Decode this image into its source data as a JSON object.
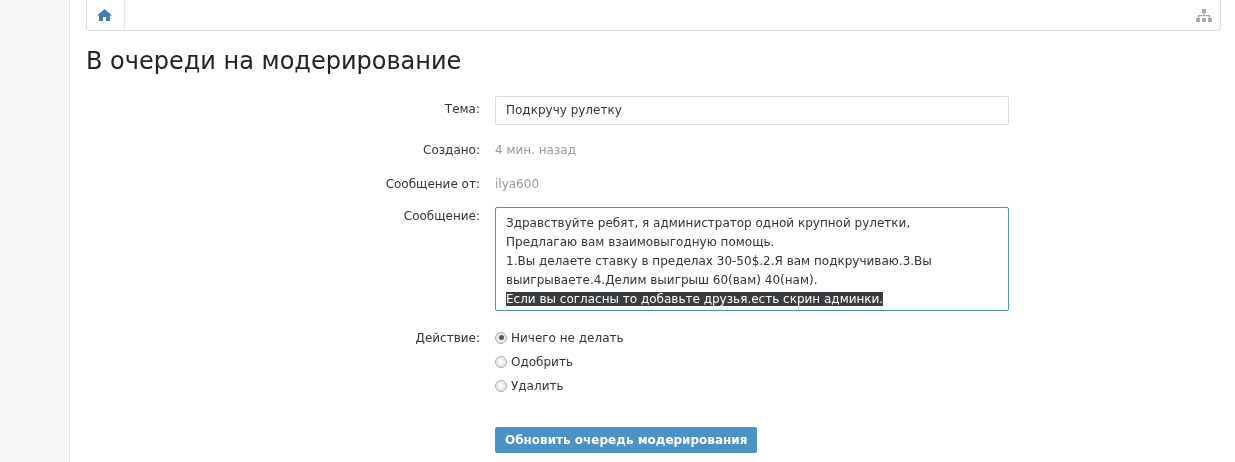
{
  "title": "В очереди на модерирование",
  "fields": [
    {
      "kind": "input",
      "label": "Тема:",
      "value": "Подкручу рулетку"
    },
    {
      "kind": "text",
      "label": "Создано:",
      "value": "4 мин. назад"
    },
    {
      "kind": "text",
      "label": "Сообщение от:",
      "value": "ilya600"
    }
  ],
  "message": {
    "label": "Сообщение:",
    "lines": [
      {
        "text": "Здравствуйте ребят, я администратор одной крупной рулетки,",
        "selected": false
      },
      {
        "text": "Предлагаю вам взаимовыгодную помощь.",
        "selected": false
      },
      {
        "text": "1.Вы делаете ставку в пределах 30-50$.2.Я вам подкручиваю.3.Вы",
        "selected": false
      },
      {
        "text": "выигрываете.4.Делим выигрыш 60(вам) 40(нам).",
        "selected": false
      },
      {
        "text": "Если вы согласны то добавьте друзья.есть скрин админки.",
        "selected": true
      }
    ]
  },
  "action": {
    "label": "Действие:",
    "options": [
      {
        "label": "Ничего не делать",
        "selected": true
      },
      {
        "label": "Одобрить",
        "selected": false
      },
      {
        "label": "Удалить",
        "selected": false
      }
    ]
  },
  "submit": "Обновить очередь модерирования"
}
